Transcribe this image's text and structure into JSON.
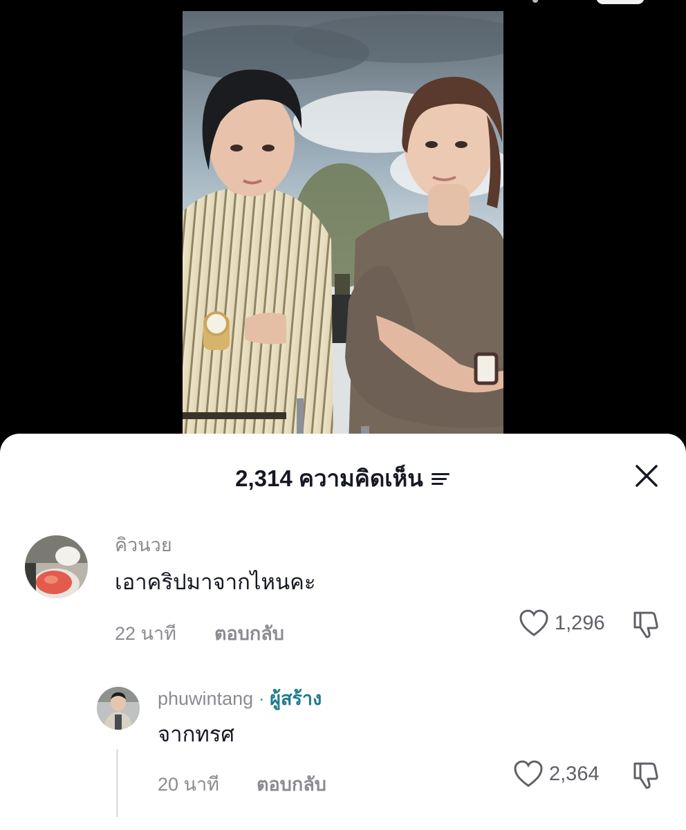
{
  "comments_sheet": {
    "count_label": "2,314 ความคิดเห็น",
    "sort_icon": "sort-lines-icon",
    "close_icon": "close-icon"
  },
  "comments": [
    {
      "username": "คิวนวย",
      "text": "เอาคริปมาจากไหนคะ",
      "time": "22 นาที",
      "reply_label": "ตอบกลับ",
      "likes": "1,296",
      "like_icon": "heart-icon",
      "dislike_icon": "thumbs-down-icon"
    },
    {
      "username": "phuwintang",
      "separator": " · ",
      "badge": "ผู้สร้าง",
      "text": "จากทรศ",
      "time": "20 นาที",
      "reply_label": "ตอบกลับ",
      "likes": "2,364",
      "like_icon": "heart-icon",
      "dislike_icon": "thumbs-down-icon"
    }
  ],
  "colors": {
    "background": "#000000",
    "sheet": "#ffffff",
    "text_primary": "#161823",
    "text_secondary": "#8a8b91",
    "creator_badge": "#1d7b8c"
  }
}
